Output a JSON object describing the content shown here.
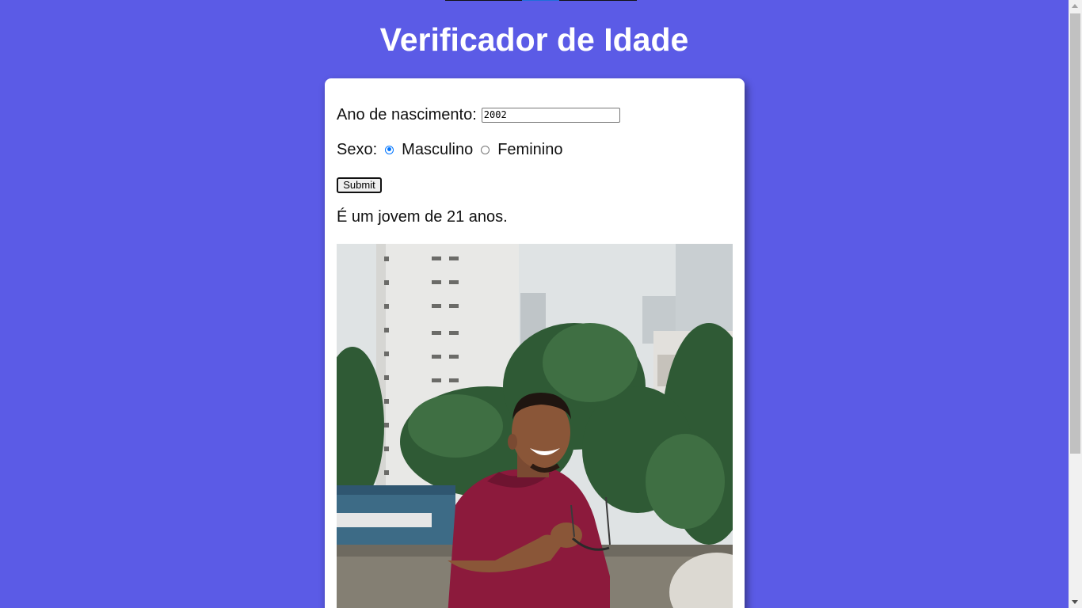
{
  "page": {
    "title": "Verificador de Idade"
  },
  "form": {
    "year_label": "Ano de nascimento:",
    "year_value": "2002",
    "sex_label": "Sexo:",
    "options": [
      {
        "label": "Masculino",
        "checked": true
      },
      {
        "label": "Feminino",
        "checked": false
      }
    ],
    "submit_label": "Submit"
  },
  "result": {
    "text": "É um jovem de 21 anos."
  },
  "photo": {
    "icon": "photo-young-man-smiling"
  },
  "colors": {
    "background": "#5b5be6",
    "card": "#ffffff",
    "title": "#ffffff",
    "shirt": "#8c1a3c",
    "radio_accent": "#0075ff"
  }
}
